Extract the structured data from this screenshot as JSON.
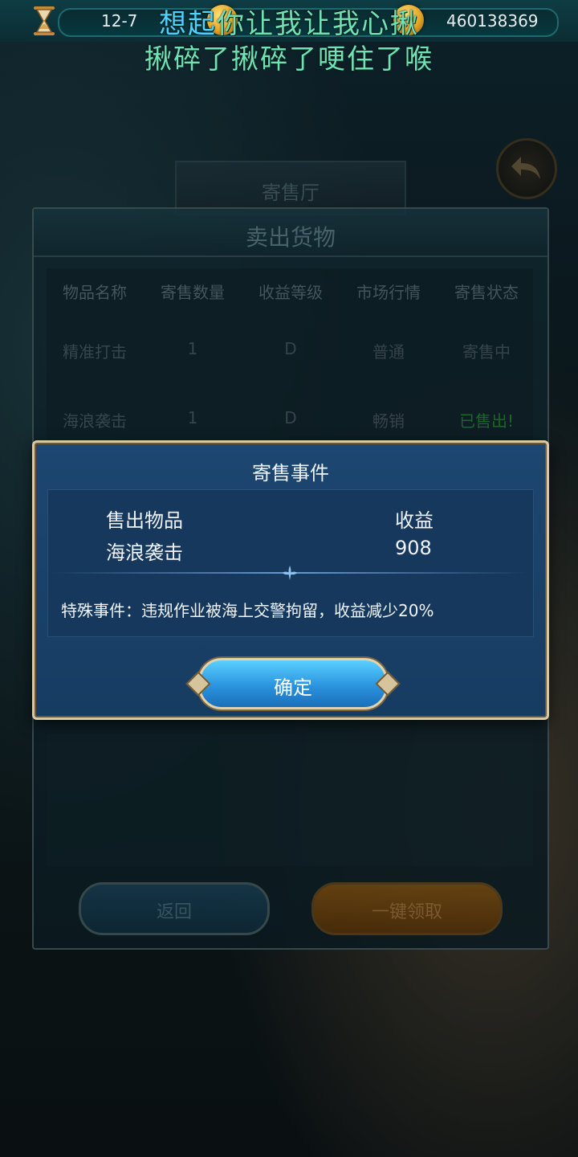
{
  "topbar": {
    "level": "12-7",
    "currency": "460138369"
  },
  "overlay": {
    "line1_prefix": "想起",
    "line1_rest": "你让我让我心揪",
    "line2": "揪碎了揪碎了哽住了喉"
  },
  "hall": {
    "title": "寄售厅"
  },
  "sell_panel": {
    "title": "卖出货物",
    "columns": [
      "物品名称",
      "寄售数量",
      "收益等级",
      "市场行情",
      "寄售状态"
    ],
    "rows": [
      [
        "精准打击",
        "1",
        "D",
        "普通",
        "寄售中"
      ],
      [
        "海浪袭击",
        "1",
        "D",
        "畅销",
        "已售出!"
      ]
    ],
    "return_label": "返回",
    "collect_label": "一键领取"
  },
  "modal": {
    "title": "寄售事件",
    "item_header": "售出物品",
    "income_header": "收益",
    "item_name": "海浪袭击",
    "income_value": "908",
    "event_text": "特殊事件：违规作业被海上交警拘留，收益减少20%",
    "confirm_label": "确定"
  },
  "colors": {
    "modal_bg": "#1d4670",
    "confirm_button": "#2a93df",
    "sold_status": "#1f6d2b",
    "overlay_text": "#6fe3b6"
  }
}
